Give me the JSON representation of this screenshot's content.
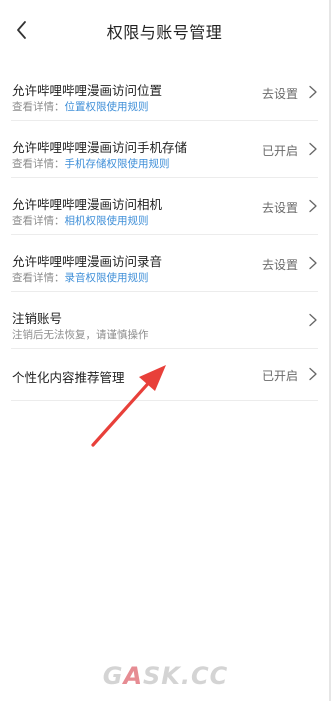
{
  "header": {
    "title": "权限与账号管理",
    "back_icon": "chevron-left-icon"
  },
  "rows": [
    {
      "title": "允许哔哩哔哩漫画访问位置",
      "sub_prefix": "查看详情：",
      "sub_link": "位置权限使用规则",
      "status": "去设置"
    },
    {
      "title": "允许哔哩哔哩漫画访问手机存储",
      "sub_prefix": "查看详情：",
      "sub_link": "手机存储权限使用规则",
      "status": "已开启"
    },
    {
      "title": "允许哔哩哔哩漫画访问相机",
      "sub_prefix": "查看详情：",
      "sub_link": "相机权限使用规则",
      "status": "去设置"
    },
    {
      "title": "允许哔哩哔哩漫画访问录音",
      "sub_prefix": "查看详情：",
      "sub_link": "录音权限使用规则",
      "status": "去设置"
    },
    {
      "title": "注销账号",
      "sub_text": "注销后无法恢复，请谨慎操作"
    },
    {
      "title": "个性化内容推荐管理",
      "status": "已开启"
    }
  ],
  "watermark": {
    "part1": "G",
    "part2": "A",
    "part3": "SK.CC"
  },
  "colors": {
    "link": "#3f8fd8",
    "annotation_arrow": "#e8403a"
  }
}
